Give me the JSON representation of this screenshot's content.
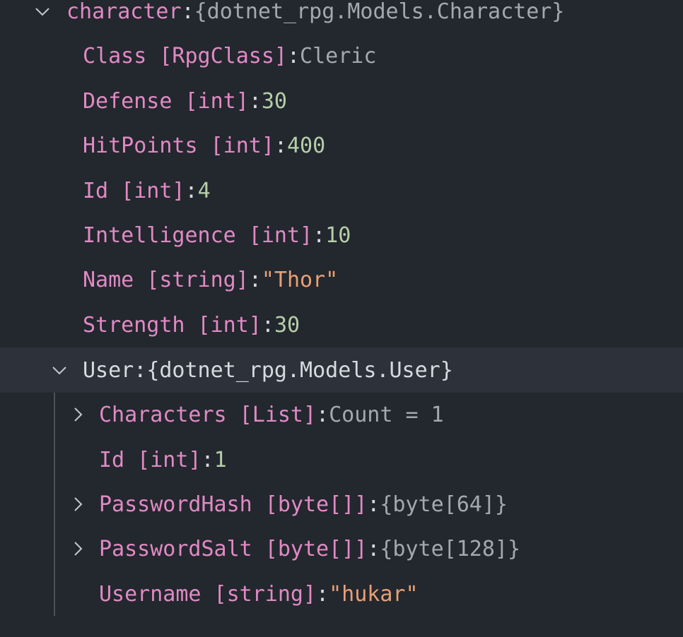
{
  "colors": {
    "background": "#23272e",
    "selected_row": "#2c313a",
    "property_name": "#e08ac4",
    "number_value": "#b5cea8",
    "string_value": "#e8a074",
    "object_value": "#a3a8b1"
  },
  "root": {
    "name": "character",
    "separator": ": ",
    "value": "{dotnet_rpg.Models.Character}",
    "expanded": true,
    "icon": "chevron-down-icon"
  },
  "character_props": [
    {
      "name": "Class [RpgClass]",
      "separator": ": ",
      "value": "Cleric",
      "kind": "enum"
    },
    {
      "name": "Defense [int]",
      "separator": ": ",
      "value": "30",
      "kind": "num"
    },
    {
      "name": "HitPoints [int]",
      "separator": ": ",
      "value": "400",
      "kind": "num"
    },
    {
      "name": "Id [int]",
      "separator": ": ",
      "value": "4",
      "kind": "num"
    },
    {
      "name": "Intelligence [int]",
      "separator": ": ",
      "value": "10",
      "kind": "num"
    },
    {
      "name": "Name [string]",
      "separator": ": ",
      "value": "\"Thor\"",
      "kind": "str"
    },
    {
      "name": "Strength [int]",
      "separator": ": ",
      "value": "30",
      "kind": "num"
    }
  ],
  "user": {
    "name": "User",
    "separator": ": ",
    "value": "{dotnet_rpg.Models.User}",
    "expanded": true,
    "icon": "chevron-down-icon"
  },
  "user_props": [
    {
      "name": "Characters [List]",
      "separator": ": ",
      "value": "Count = 1",
      "kind": "obj",
      "expandable": true,
      "icon": "chevron-right-icon"
    },
    {
      "name": "Id [int]",
      "separator": ": ",
      "value": "1",
      "kind": "num",
      "expandable": false
    },
    {
      "name": "PasswordHash [byte[]]",
      "separator": ": ",
      "value": "{byte[64]}",
      "kind": "obj",
      "expandable": true,
      "icon": "chevron-right-icon"
    },
    {
      "name": "PasswordSalt [byte[]]",
      "separator": ": ",
      "value": "{byte[128]}",
      "kind": "obj",
      "expandable": true,
      "icon": "chevron-right-icon"
    },
    {
      "name": "Username [string]",
      "separator": ": ",
      "value": "\"hukar\"",
      "kind": "str",
      "expandable": false
    }
  ]
}
